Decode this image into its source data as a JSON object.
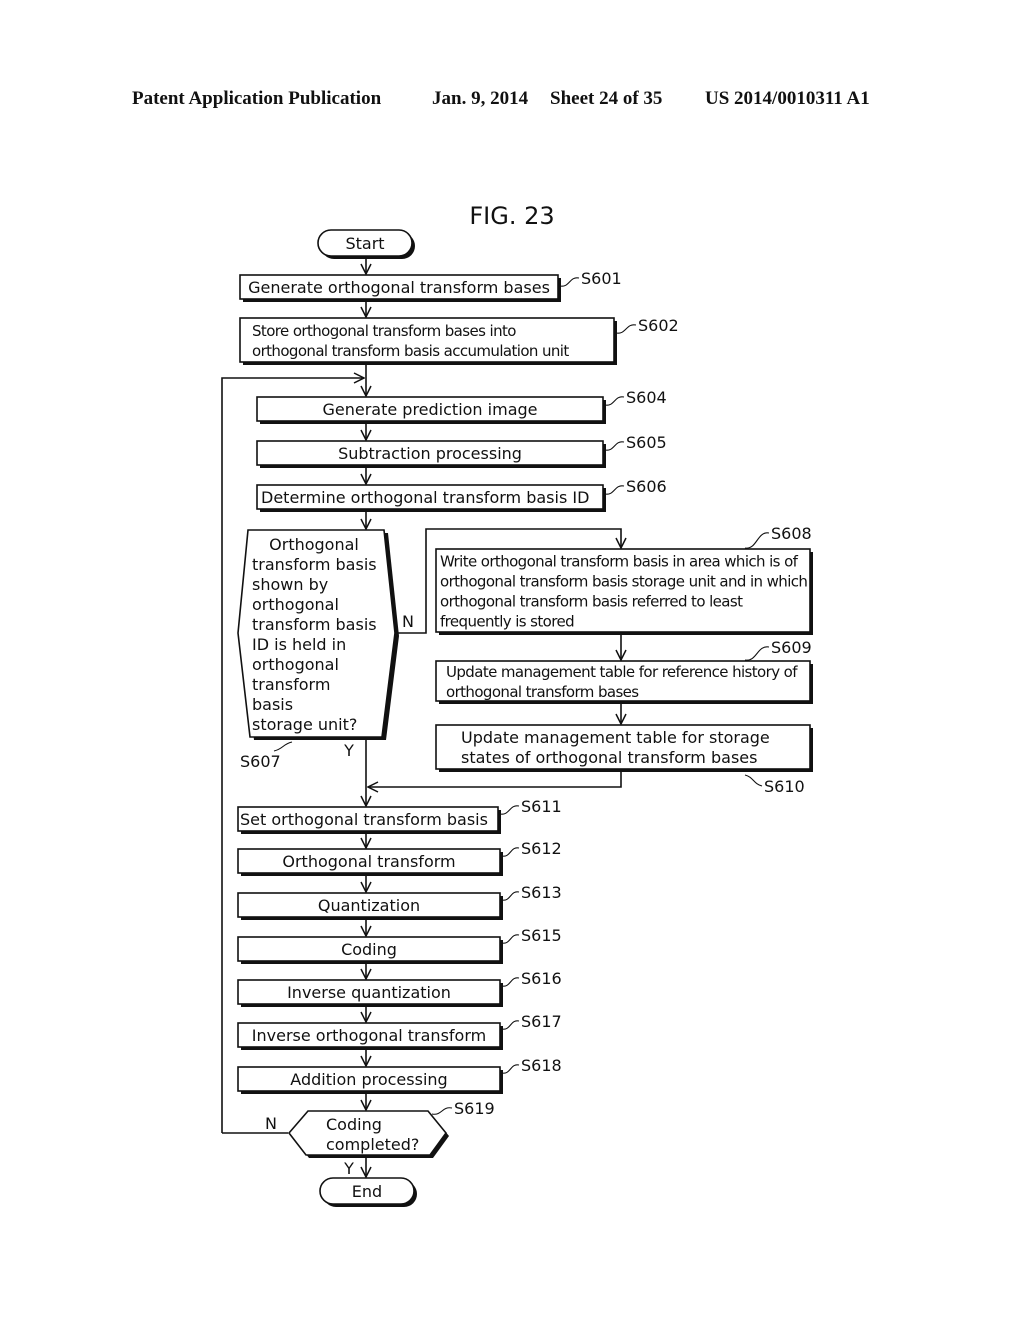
{
  "header": {
    "publication": "Patent Application Publication",
    "date": "Jan. 9, 2014",
    "sheet": "Sheet 24 of 35",
    "number": "US 2014/0010311 A1"
  },
  "figure": {
    "title": "FIG. 23",
    "terminals": {
      "start": "Start",
      "end": "End"
    },
    "steps": {
      "S601": {
        "label": "S601",
        "lines": [
          "Generate orthogonal transform bases"
        ]
      },
      "S602": {
        "label": "S602",
        "lines": [
          "Store orthogonal transform bases into",
          "orthogonal transform basis accumulation unit"
        ]
      },
      "S604": {
        "label": "S604",
        "lines": [
          "Generate prediction image"
        ]
      },
      "S605": {
        "label": "S605",
        "lines": [
          "Subtraction processing"
        ]
      },
      "S606": {
        "label": "S606",
        "lines": [
          "Determine orthogonal transform basis ID"
        ]
      },
      "S607": {
        "label": "S607",
        "lines": [
          "Orthogonal",
          "transform basis",
          "shown by",
          "orthogonal",
          "transform basis",
          "ID is held in",
          "orthogonal",
          "transform",
          "basis",
          "storage unit?"
        ],
        "yes": "Y",
        "no": "N"
      },
      "S608": {
        "label": "S608",
        "lines": [
          "Write orthogonal transform basis in area which is of",
          "orthogonal transform basis storage unit and in which",
          "orthogonal transform basis referred to least",
          "frequently is stored"
        ]
      },
      "S609": {
        "label": "S609",
        "lines": [
          "Update management table for reference history of",
          "orthogonal transform bases"
        ]
      },
      "S610": {
        "label": "S610",
        "lines": [
          "Update management table for storage",
          "states of orthogonal transform bases"
        ]
      },
      "S611": {
        "label": "S611",
        "lines": [
          "Set orthogonal transform basis"
        ]
      },
      "S612": {
        "label": "S612",
        "lines": [
          "Orthogonal transform"
        ]
      },
      "S613": {
        "label": "S613",
        "lines": [
          "Quantization"
        ]
      },
      "S615": {
        "label": "S615",
        "lines": [
          "Coding"
        ]
      },
      "S616": {
        "label": "S616",
        "lines": [
          "Inverse quantization"
        ]
      },
      "S617": {
        "label": "S617",
        "lines": [
          "Inverse orthogonal transform"
        ]
      },
      "S618": {
        "label": "S618",
        "lines": [
          "Addition processing"
        ]
      },
      "S619": {
        "label": "S619",
        "lines": [
          "Coding",
          "completed?"
        ],
        "yes": "Y",
        "no": "N"
      }
    }
  }
}
